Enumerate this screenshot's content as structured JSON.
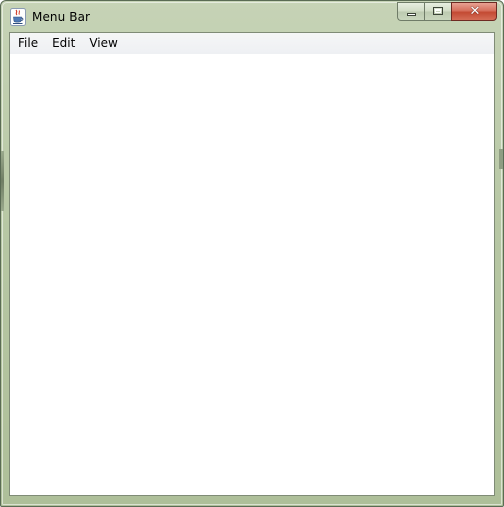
{
  "window": {
    "title": "Menu Bar",
    "icon": "java-cup-icon",
    "frame_color": "#b7c7a4",
    "close_button_color": "#c7503a"
  },
  "caption_buttons": {
    "minimize": "minimize-icon",
    "maximize": "maximize-icon",
    "close": "close-icon"
  },
  "menubar": {
    "items": [
      {
        "label": "File"
      },
      {
        "label": "Edit"
      },
      {
        "label": "View"
      }
    ]
  }
}
